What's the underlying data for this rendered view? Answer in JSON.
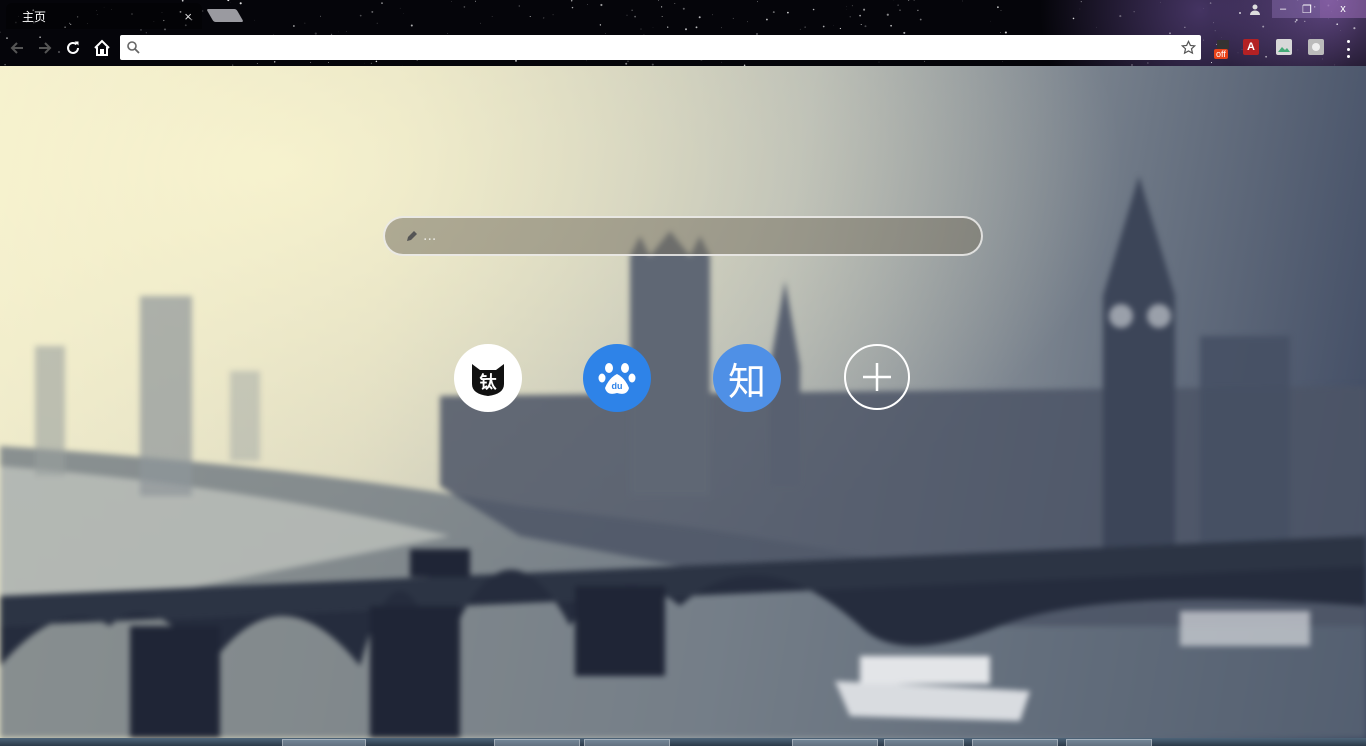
{
  "tab": {
    "title": "主页",
    "close_glyph": "×"
  },
  "window_controls": {
    "minimize": "–",
    "maximize": "❐",
    "close": "x"
  },
  "omnibox": {
    "value": "",
    "placeholder": ""
  },
  "extensions": {
    "off_badge": "off",
    "a_badge": "A"
  },
  "newtab_search": {
    "placeholder": "..."
  },
  "shortcuts": [
    {
      "name": "钛",
      "icon": "titanium-cat-icon",
      "color": "#ffffff"
    },
    {
      "name": "du",
      "icon": "baidu-paw-icon",
      "color": "#2e83e8"
    },
    {
      "name": "知",
      "icon": "zhihu-icon",
      "color": "#4f90e6"
    },
    {
      "name": "+",
      "icon": "add-icon",
      "color": "transparent"
    }
  ]
}
